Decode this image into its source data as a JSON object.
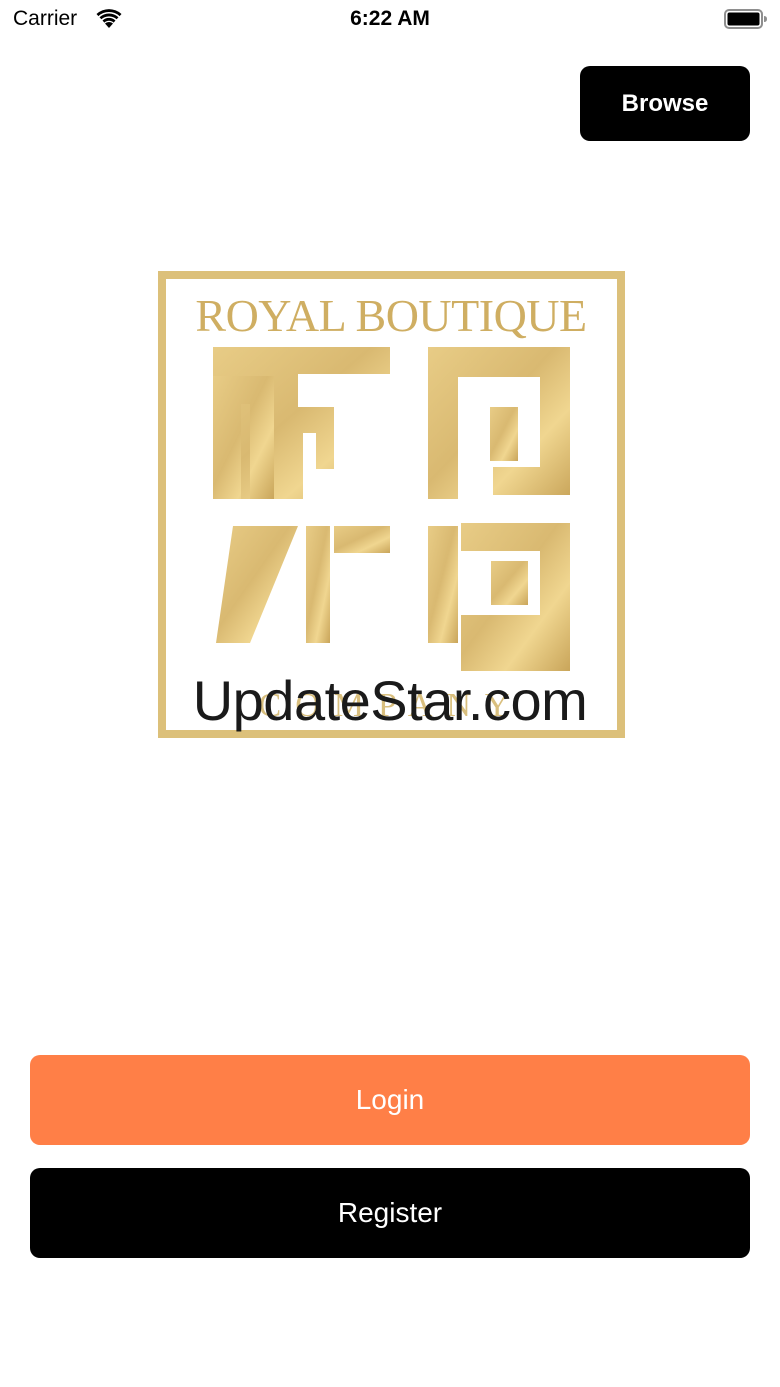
{
  "status_bar": {
    "carrier": "Carrier",
    "time": "6:22 AM",
    "wifi_icon": "wifi-icon",
    "battery_icon": "battery-icon"
  },
  "header": {
    "browse_label": "Browse"
  },
  "logo": {
    "name": "Royal Boutique Company",
    "top_text": "ROYAL BOUTIQUE",
    "bottom_text": "COMPANY",
    "gold": "#d4b46a",
    "gold_dark": "#b8964a",
    "gold_light": "#ecd08a"
  },
  "watermark": {
    "text": "UpdateStar.com"
  },
  "actions": {
    "login_label": "Login",
    "register_label": "Register",
    "login_color": "#ff7f47",
    "register_color": "#000000"
  }
}
